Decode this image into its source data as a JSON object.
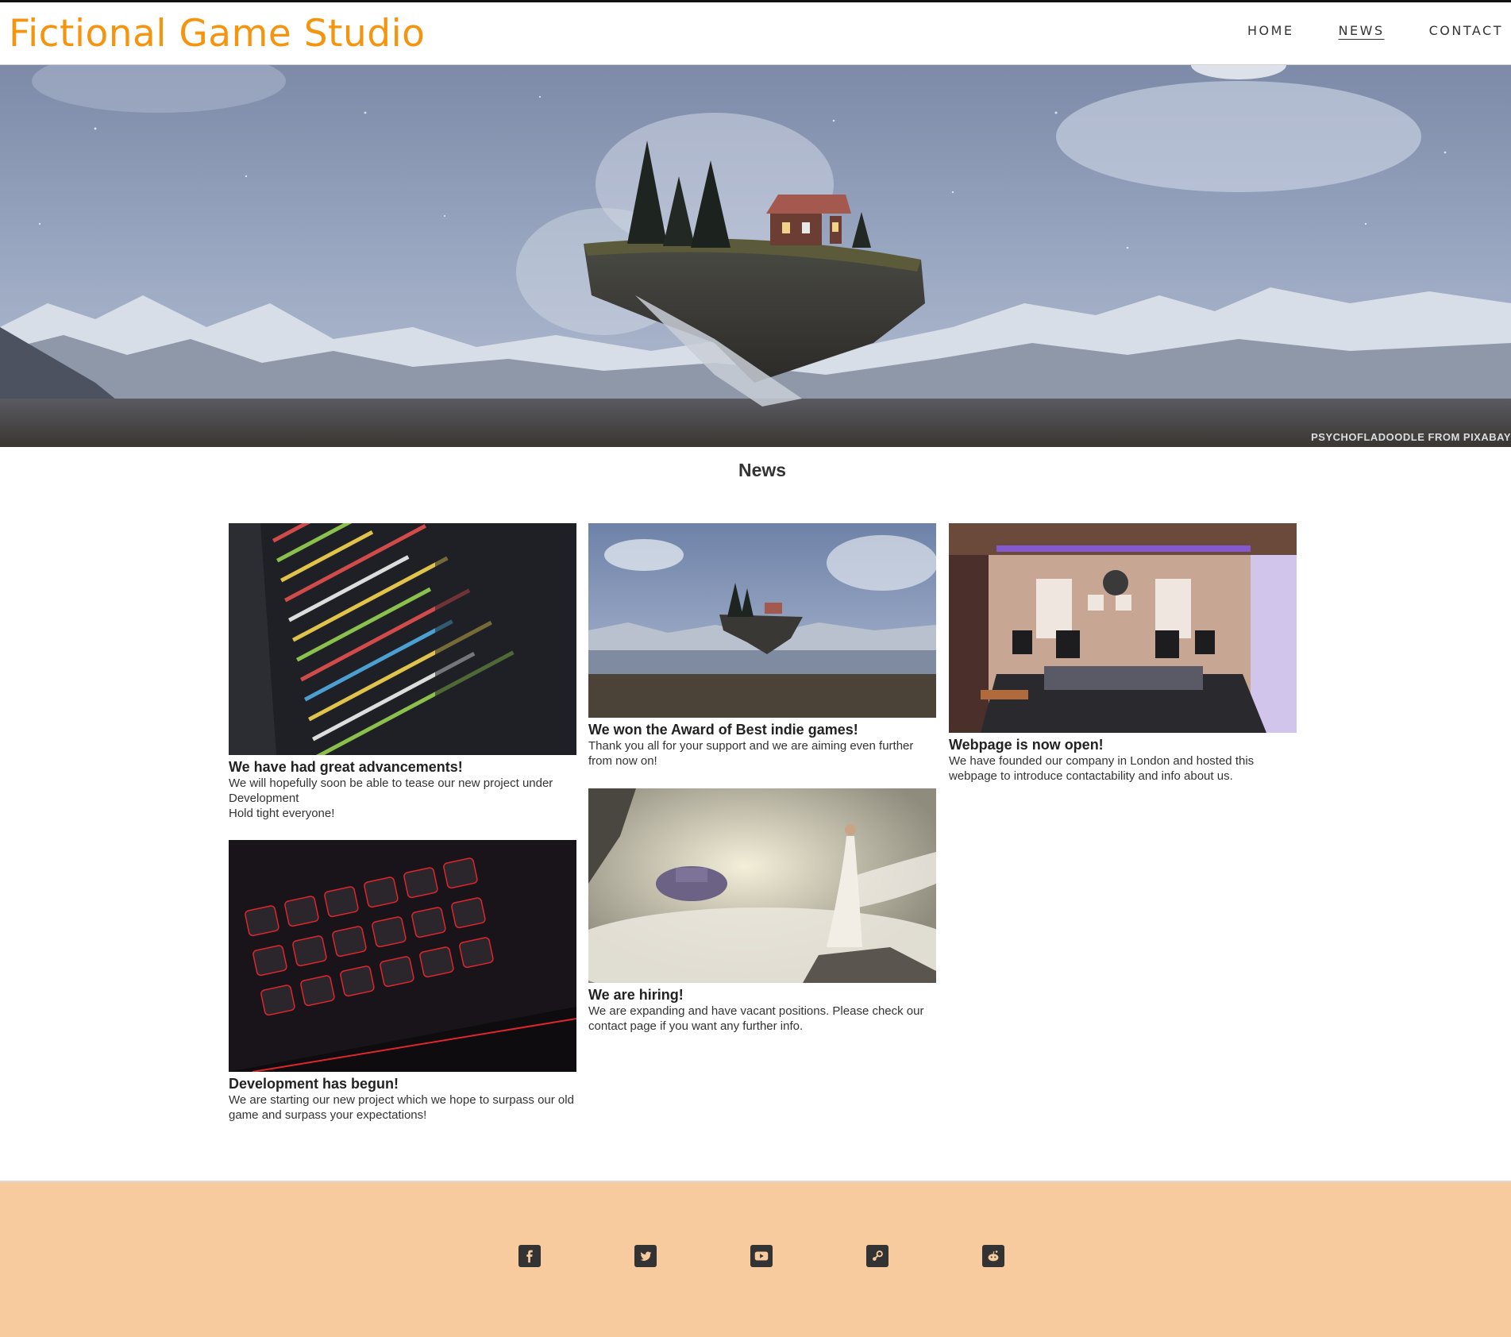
{
  "header": {
    "brand": "Fictional Game Studio",
    "nav": [
      {
        "label": "HOME",
        "active": false
      },
      {
        "label": "NEWS",
        "active": true
      },
      {
        "label": "CONTACT",
        "active": false
      }
    ]
  },
  "hero": {
    "credit": "PSYCHOFLADOODLE FROM PIXABAY"
  },
  "news": {
    "title": "News",
    "cards": [
      {
        "image": "code-on-screen",
        "title": "We have had great advancements!",
        "text": "We will hopefully soon be able to tease our new project under Development\nHold tight everyone!"
      },
      {
        "image": "keyboard-red-backlight",
        "title": "Development has begun!",
        "text": "We are starting our new project which we hope to surpass our old game and surpass your expectations!"
      },
      {
        "image": "floating-island-lake",
        "title": "We won the Award of Best indie games!",
        "text": "Thank you all for your support and we are aiming even further from now on!"
      },
      {
        "image": "woman-cliff-floating-city",
        "title": "We are hiring!",
        "text": "We are expanding and have vacant positions. Please check our contact page if you want any further info."
      },
      {
        "image": "music-studio",
        "title": "Webpage is now open!",
        "text": "We have founded our company in London and hosted this webpage to introduce contactability and info about us."
      }
    ]
  },
  "footer": {
    "social": [
      "facebook-icon",
      "twitter-icon",
      "youtube-icon",
      "steam-icon",
      "reddit-icon"
    ]
  },
  "colors": {
    "brand": "#f5950f",
    "footer_bg": "#f7cb9d",
    "text": "#222222"
  }
}
